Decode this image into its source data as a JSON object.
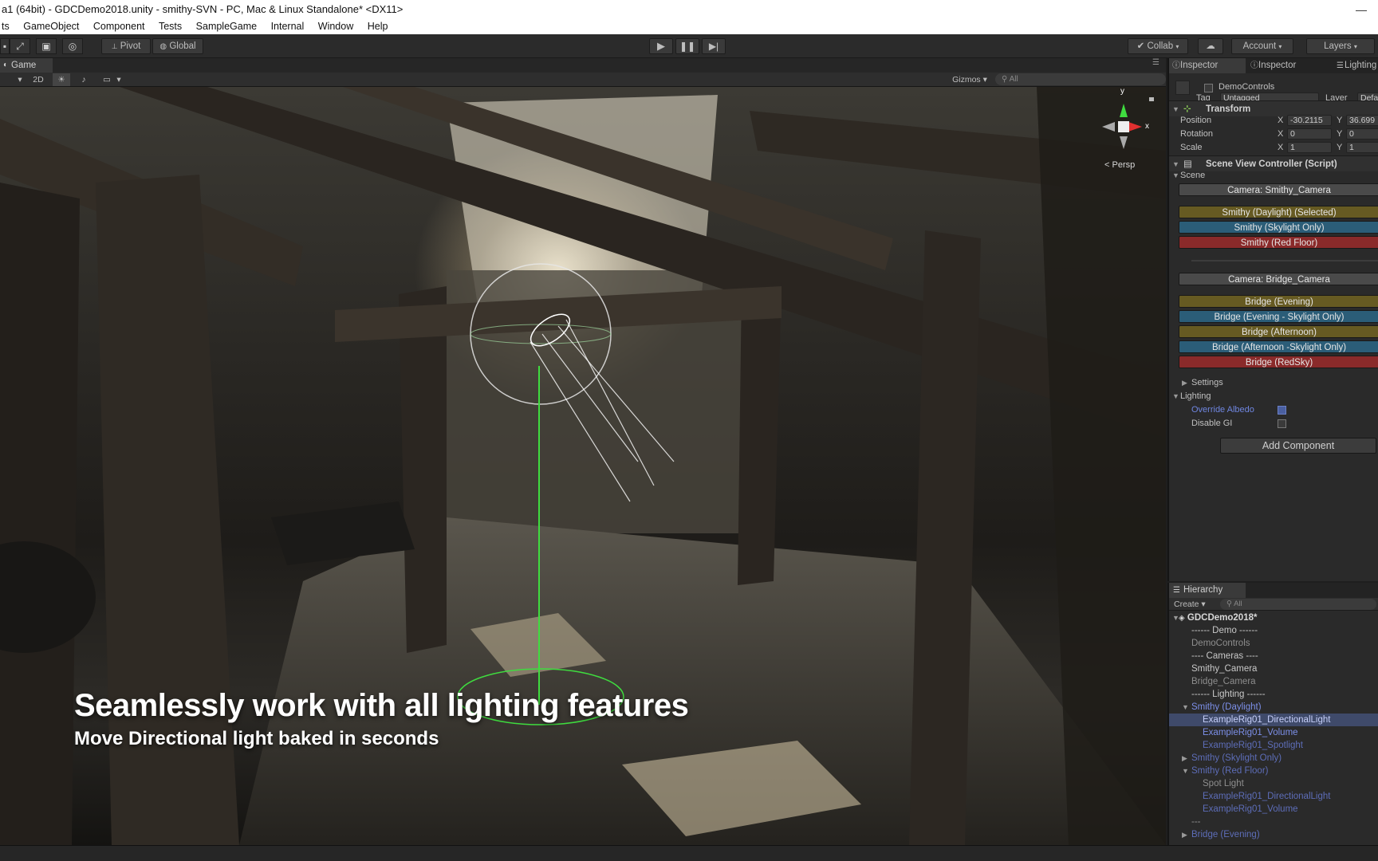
{
  "window": {
    "title": "a1 (64bit) - GDCDemo2018.unity - smithy-SVN - PC, Mac & Linux Standalone* <DX11>",
    "minimize_glyph": "—"
  },
  "menu": [
    "ts",
    "GameObject",
    "Component",
    "Tests",
    "SampleGame",
    "Internal",
    "Window",
    "Help"
  ],
  "toolbar": {
    "pivot_label": "Pivot",
    "global_label": "Global",
    "collab_label": "Collab",
    "account_label": "Account",
    "layers_label": "Layers"
  },
  "game_tab": {
    "label": "Game"
  },
  "scene_bar": {
    "mode_2d": "2D",
    "gizmos_label": "Gizmos",
    "search_placeholder": "All"
  },
  "viewport": {
    "persp_label": "Persp",
    "axis_y": "y",
    "axis_x": "x",
    "overlay_title": "Seamlessly work with all lighting features",
    "overlay_subtitle": "Move Directional light baked in seconds"
  },
  "inspector": {
    "tabs": [
      "Inspector",
      "Inspector",
      "Lighting"
    ],
    "object_name": "DemoControls",
    "tag_label": "Tag",
    "tag_value": "Untagged",
    "layer_label": "Layer",
    "layer_value": "Defa",
    "transform": {
      "title": "Transform",
      "position_label": "Position",
      "rotation_label": "Rotation",
      "scale_label": "Scale",
      "x_label": "X",
      "y_label": "Y",
      "position_x": "-30.2115",
      "position_y": "36.699",
      "rotation_x": "0",
      "rotation_y": "0",
      "scale_x": "1",
      "scale_y": "1"
    },
    "script": {
      "title": "Scene View Controller (Script)",
      "scene_label": "Scene",
      "buttons": [
        "Camera: Smithy_Camera",
        "Smithy (Daylight) (Selected)",
        "Smithy (Skylight Only)",
        "Smithy (Red Floor)",
        "Camera: Bridge_Camera",
        "Bridge (Evening)",
        "Bridge (Evening - Skylight Only)",
        "Bridge (Afternoon)",
        "Bridge (Afternoon -Skylight Only)",
        "Bridge (RedSky)"
      ],
      "settings_label": "Settings",
      "lighting_label": "Lighting",
      "override_albedo_label": "Override Albedo",
      "disable_gi_label": "Disable GI"
    },
    "add_component_label": "Add Component"
  },
  "hierarchy": {
    "tab_label": "Hierarchy",
    "create_label": "Create",
    "search_placeholder": "All",
    "scene_name": "GDCDemo2018*",
    "items": [
      "------ Demo ------",
      "DemoControls",
      "---- Cameras ----",
      "Smithy_Camera",
      "Bridge_Camera",
      "------ Lighting ------",
      "Smithy (Daylight)",
      "ExampleRig01_DirectionalLight",
      "ExampleRig01_Volume",
      "ExampleRig01_Spotlight",
      "Smithy (Skylight Only)",
      "Smithy (Red Floor)",
      "Spot Light",
      "ExampleRig01_DirectionalLight",
      "ExampleRig01_Volume",
      "---",
      "Bridge (Evening)"
    ]
  },
  "colors": {
    "button_gray": "#4a4a4a",
    "button_olive": "#665a22",
    "button_teal": "#2b5d78",
    "button_red": "#8a2a2a",
    "hierarchy_blue": "#7c8fe8",
    "selection": "#3f4a6a"
  },
  "icons": [
    "play-icon",
    "pause-icon",
    "step-icon",
    "cloud-icon",
    "unity-scene-icon",
    "script-icon",
    "transform-icon",
    "sun-icon",
    "audio-icon",
    "image-icon"
  ]
}
